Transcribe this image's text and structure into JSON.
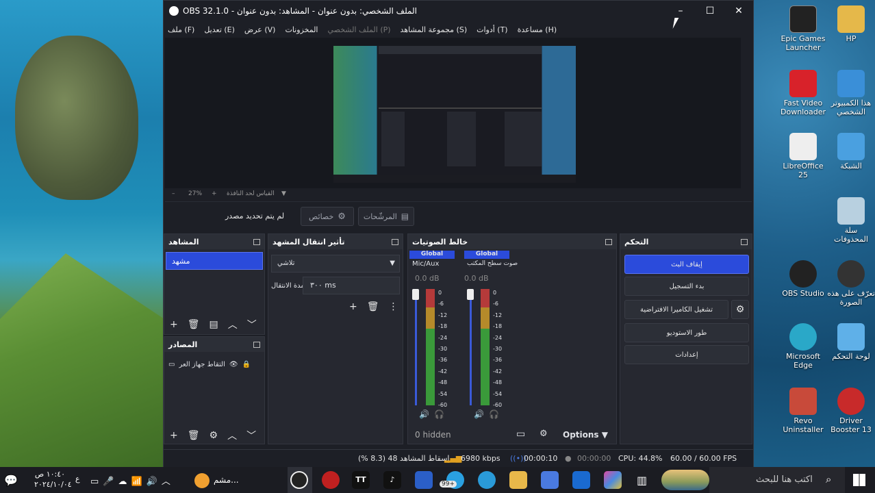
{
  "window": {
    "title": "OBS 32.1.0 - الملف الشخصي: بدون عنوان - المشاهد: بدون عنوان",
    "minimize": "–",
    "maximize": "☐",
    "close": "✕"
  },
  "menu": {
    "file": "ملف (F)",
    "edit": "تعديل (E)",
    "view": "عرض (V)",
    "docks": "المخزونات",
    "profile": "الملف الشخصي (P)",
    "scene_collection": "مجموعة المشاهد (S)",
    "tools": "أدوات (T)",
    "help": "مساعدة (H)"
  },
  "preview": {
    "zoom": "27%",
    "zoom_minus": "–",
    "zoom_plus": "+",
    "scale_label": "القياس لحد النافذة"
  },
  "context": {
    "no_source": "لم يتم تحديد مصدر",
    "properties": "خصائص",
    "filters": "المرشّحات"
  },
  "scenes": {
    "title": "المشاهد",
    "items": [
      "مشهد"
    ]
  },
  "sources": {
    "title": "المصادر",
    "items": [
      "التقاط جهاز العر"
    ]
  },
  "transitions": {
    "title": "تأثير انتقال المشهد",
    "type": "تلاشي",
    "duration_label": "مدة الانتقال",
    "duration_value": "٣٠٠ ms"
  },
  "mixer": {
    "title": "خالط الصوتيات",
    "channels": [
      {
        "badge": "Global",
        "name": "Mic/Aux",
        "db": "0.0 dB"
      },
      {
        "badge": "Global",
        "name": "صوت سطح المكتب",
        "db": "0.0 dB"
      }
    ],
    "scale": [
      "0",
      "-6",
      "-12",
      "-18",
      "-24",
      "-30",
      "-36",
      "-42",
      "-48",
      "-54",
      "-60"
    ],
    "hidden": "0 hidden",
    "options": "Options"
  },
  "controls": {
    "title": "التحكم",
    "stop_stream": "إيقاف البث",
    "start_record": "بدء التسجيل",
    "virtual_cam": "تشغيل الكاميرا الافتراضية",
    "studio_mode": "طور الاستوديو",
    "settings": "إعدادات"
  },
  "status": {
    "dropped": "إسقاط المشاهد 48 (8.3 %)",
    "kbps": "6980 kbps",
    "stream_time": "00:00:10",
    "record_time": "00:00:00",
    "cpu": "CPU: 44.8%",
    "fps": "60.00 / 60.00 FPS"
  },
  "desktop": {
    "icons": [
      {
        "label": "Epic Games Launcher"
      },
      {
        "label": "HP"
      },
      {
        "label": "Fast Video Downloader"
      },
      {
        "label": "هذا الكمبيوتر الشخصي"
      },
      {
        "label": "LibreOffice 25"
      },
      {
        "label": "الشبكة"
      },
      {
        "label": "سلة المحذوفات"
      },
      {
        "label": "OBS Studio"
      },
      {
        "label": "تعرّف على هذه الصورة"
      },
      {
        "label": "Microsoft Edge"
      },
      {
        "label": "لوحة التحكم"
      },
      {
        "label": "Revo Uninstaller"
      },
      {
        "label": "Driver Booster 13"
      }
    ]
  },
  "taskbar": {
    "search": "اكتب هنا للبحث",
    "time": "١٠:٤٠ ص",
    "date": "٢٠٢٤/١٠/٠٤",
    "weather_app": "مشم...",
    "notif_badge": "99+",
    "lang": "ع"
  }
}
